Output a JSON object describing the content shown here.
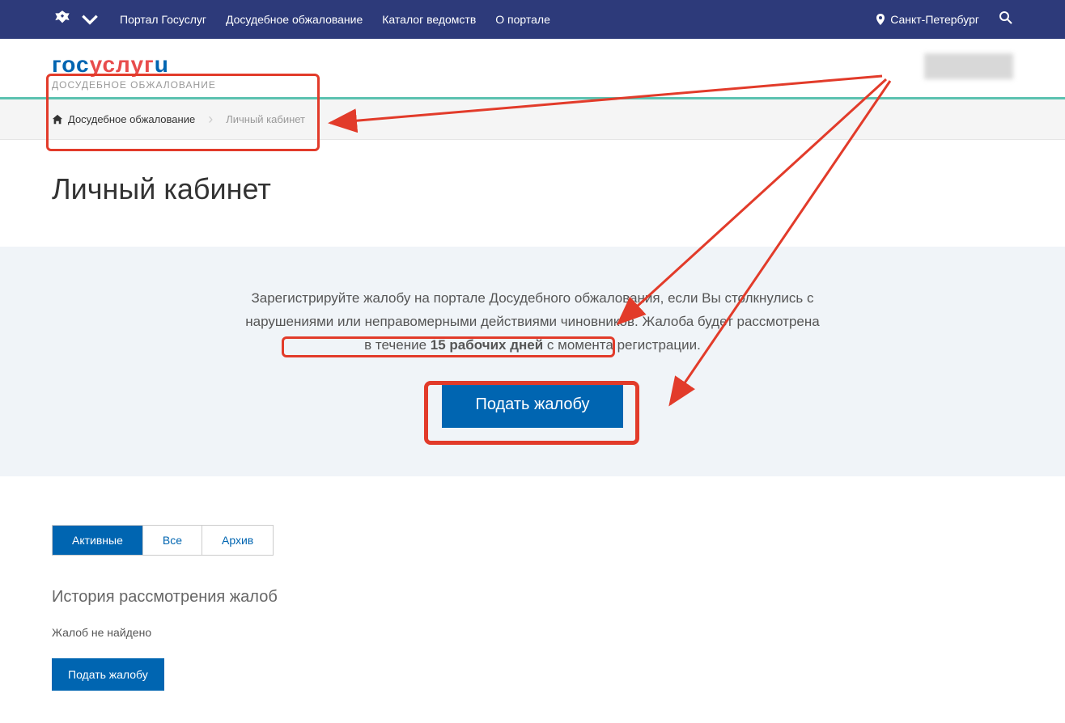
{
  "topnav": {
    "items": [
      "Портал Госуслуг",
      "Досудебное обжалование",
      "Каталог ведомств",
      "О портале"
    ],
    "location": "Санкт-Петербург"
  },
  "logo": {
    "part1": "гос",
    "part2": "услуг",
    "part3": "u",
    "subtitle": "ДОСУДЕБНОЕ ОБЖАЛОВАНИЕ"
  },
  "breadcrumb": {
    "home": "Досудебное обжалование",
    "current": "Личный кабинет"
  },
  "page": {
    "title": "Личный кабинет"
  },
  "hero": {
    "text_before": "Зарегистрируйте жалобу на портале Досудебного обжалования, если Вы столкнулись с нарушениями или неправомерными действиями чиновников. Жалоба будет рассмотрена в течение ",
    "text_bold": "15 рабочих дней",
    "text_after": " с момента регистрации.",
    "button": "Подать жалобу"
  },
  "tabs": {
    "items": [
      "Активные",
      "Все",
      "Архив"
    ],
    "active_index": 0
  },
  "history": {
    "title": "История рассмотрения жалоб",
    "empty": "Жалоб не найдено",
    "button": "Подать жалобу"
  },
  "annotation": {
    "color": "#e23b2a"
  }
}
